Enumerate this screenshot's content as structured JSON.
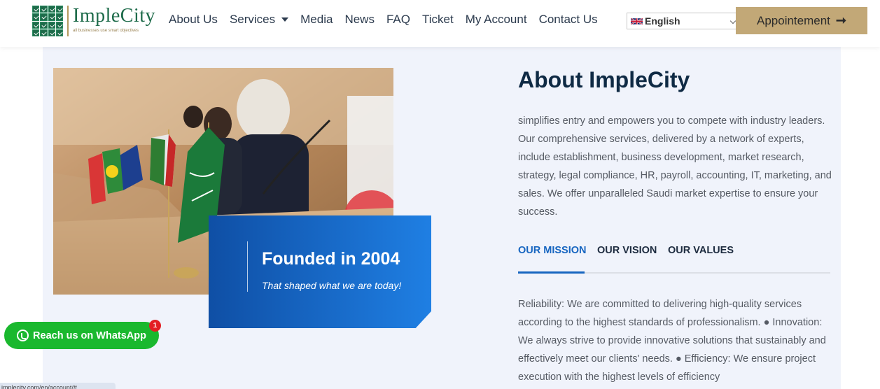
{
  "logo": {
    "title": "ImpleCity",
    "tagline": "all businesses use smart objectives"
  },
  "nav": {
    "items": [
      "About Us",
      "Services",
      "Media",
      "News",
      "FAQ",
      "Ticket",
      "My Account",
      "Contact Us"
    ]
  },
  "language": {
    "selected": "English"
  },
  "appointment": {
    "label": "Appointement",
    "icon": "arrow-right-icon"
  },
  "colors": {
    "gold": "#c2a877",
    "brand_green": "#1e6b4a",
    "accent_blue": "#1665c0",
    "whatsapp_green": "#1ab82e",
    "panel_bg": "#f0f3fb"
  },
  "founded": {
    "title": "Founded in 2004",
    "subtitle": "That shaped what we are today!"
  },
  "about": {
    "title": "About ImpleCity",
    "description": "simplifies entry and empowers you to compete with industry leaders. Our comprehensive services, delivered by a network of experts, include establishment, business development, market research, strategy, legal compliance, HR, payroll, accounting, IT, marketing, and sales. We offer unparalleled Saudi market expertise to ensure your success."
  },
  "tabs": [
    {
      "label": "OUR MISSION",
      "active": true
    },
    {
      "label": "OUR VISION",
      "active": false
    },
    {
      "label": "OUR VALUES",
      "active": false
    }
  ],
  "mission_text": "Reliability: We are committed to delivering high-quality services according to the highest standards of professionalism. ● Innovation: We always strive to provide innovative solutions that sustainably and effectively meet our clients' needs. ● Efficiency: We ensure project execution with the highest levels of efficiency",
  "whatsapp": {
    "label": "Reach us on WhatsApp",
    "badge": "1"
  },
  "status_bar": {
    "url": "implecity.com/en/account/#"
  }
}
